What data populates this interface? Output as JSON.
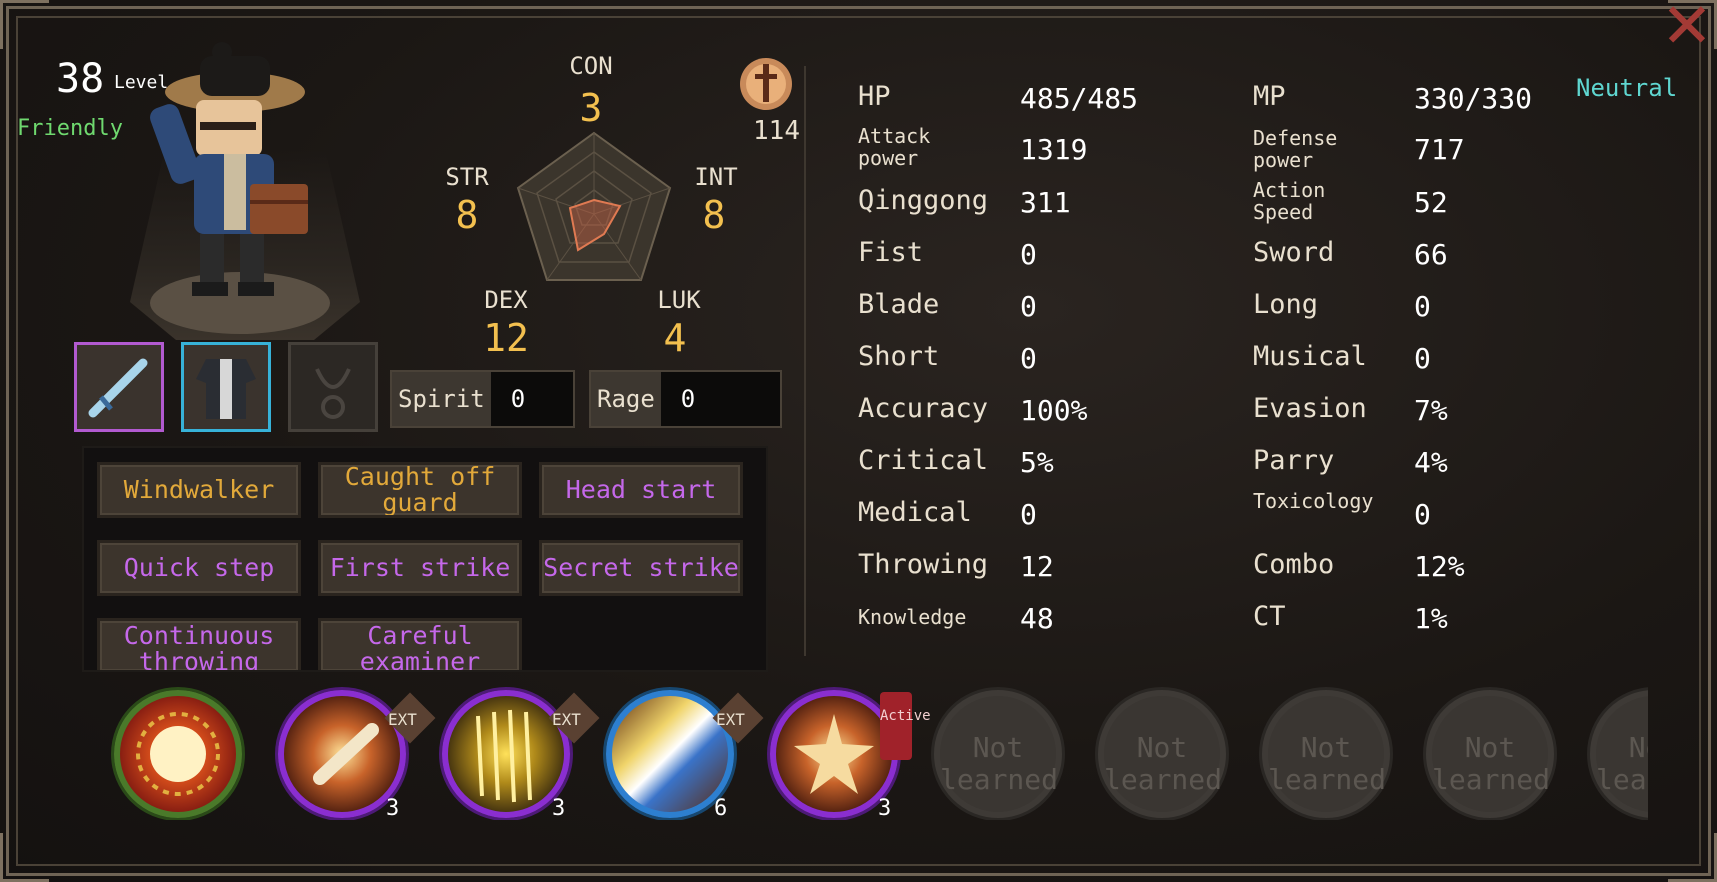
{
  "character": {
    "level": "38",
    "level_label": "Level",
    "relation": "Friendly"
  },
  "attributes": {
    "con": {
      "label": "CON",
      "value": "3"
    },
    "str": {
      "label": "STR",
      "value": "8"
    },
    "int": {
      "label": "INT",
      "value": "8"
    },
    "dex": {
      "label": "DEX",
      "value": "12"
    },
    "luk": {
      "label": "LUK",
      "value": "4"
    }
  },
  "fame": {
    "value": "114",
    "icon": "sword-emblem-icon"
  },
  "equipment": {
    "weapon": {
      "icon": "sword-icon",
      "color": "#b25ad0"
    },
    "armor": {
      "icon": "robe-icon",
      "color": "#37b2d8"
    },
    "accessory": {
      "icon": "pendant-icon",
      "color": "#45403a"
    }
  },
  "meters": {
    "spirit": {
      "label": "Spirit",
      "value": "0"
    },
    "rage": {
      "label": "Rage",
      "value": "0"
    }
  },
  "traits": [
    {
      "label": "Windwalker",
      "color": "gold"
    },
    {
      "label": "Caught off guard",
      "color": "gold"
    },
    {
      "label": "Head start",
      "color": "purple"
    },
    {
      "label": "Quick step",
      "color": "purple"
    },
    {
      "label": "First strike",
      "color": "purple"
    },
    {
      "label": "Secret strike",
      "color": "purple"
    },
    {
      "label": "Continuous throwing",
      "color": "purple"
    },
    {
      "label": "Careful examiner",
      "color": "purple"
    }
  ],
  "alignment": "Neutral",
  "stats": {
    "left": [
      {
        "label": "HP",
        "value": "485/485"
      },
      {
        "label": "Attack power",
        "value": "1319"
      },
      {
        "label": "Qinggong",
        "value": "311"
      },
      {
        "label": "Fist",
        "value": "0"
      },
      {
        "label": "Blade",
        "value": "0"
      },
      {
        "label": "Short",
        "value": "0"
      },
      {
        "label": "Accuracy",
        "value": "100%"
      },
      {
        "label": "Critical",
        "value": "5%"
      },
      {
        "label": "Medical",
        "value": "0"
      },
      {
        "label": "Throwing",
        "value": "12"
      },
      {
        "label": "Knowledge",
        "value": "48"
      }
    ],
    "right": [
      {
        "label": "MP",
        "value": "330/330"
      },
      {
        "label": "Defense power",
        "value": "717"
      },
      {
        "label": "Action Speed",
        "value": "52"
      },
      {
        "label": "Sword",
        "value": "66"
      },
      {
        "label": "Long",
        "value": "0"
      },
      {
        "label": "Musical",
        "value": "0"
      },
      {
        "label": "Evasion",
        "value": "7%"
      },
      {
        "label": "Parry",
        "value": "4%"
      },
      {
        "label": "Toxicology",
        "value": "0"
      },
      {
        "label": "Combo",
        "value": "12%"
      },
      {
        "label": "CT",
        "value": "1%"
      }
    ]
  },
  "skills": [
    {
      "icon": "palm-skill-icon",
      "style": "green",
      "count": "",
      "badge": ""
    },
    {
      "icon": "blade-burst-skill-icon",
      "style": "purple",
      "count": "3",
      "badge": "EXT"
    },
    {
      "icon": "golden-rain-skill-icon",
      "style": "purple rain",
      "count": "3",
      "badge": "EXT"
    },
    {
      "icon": "flying-daggers-skill-icon",
      "style": "blue",
      "count": "6",
      "badge": "EXT"
    },
    {
      "icon": "star-burst-skill-icon",
      "style": "purple",
      "count": "3",
      "badge": "Active"
    },
    {
      "icon": "locked-skill-icon",
      "style": "locked",
      "lock_text": "Not learned"
    },
    {
      "icon": "locked-skill-icon",
      "style": "locked",
      "lock_text": "Not learned"
    },
    {
      "icon": "locked-skill-icon",
      "style": "locked",
      "lock_text": "Not learned"
    },
    {
      "icon": "locked-skill-icon",
      "style": "locked",
      "lock_text": "Not learned"
    },
    {
      "icon": "locked-skill-icon",
      "style": "locked",
      "lock_text": "Not learned"
    }
  ],
  "colors": {
    "stat_value": "#f3c04f",
    "relation": "#6fd96f",
    "alignment": "#5fd6d0",
    "trait_gold": "#e2a93a",
    "trait_purple": "#c568ea",
    "close": "#a33a35"
  }
}
